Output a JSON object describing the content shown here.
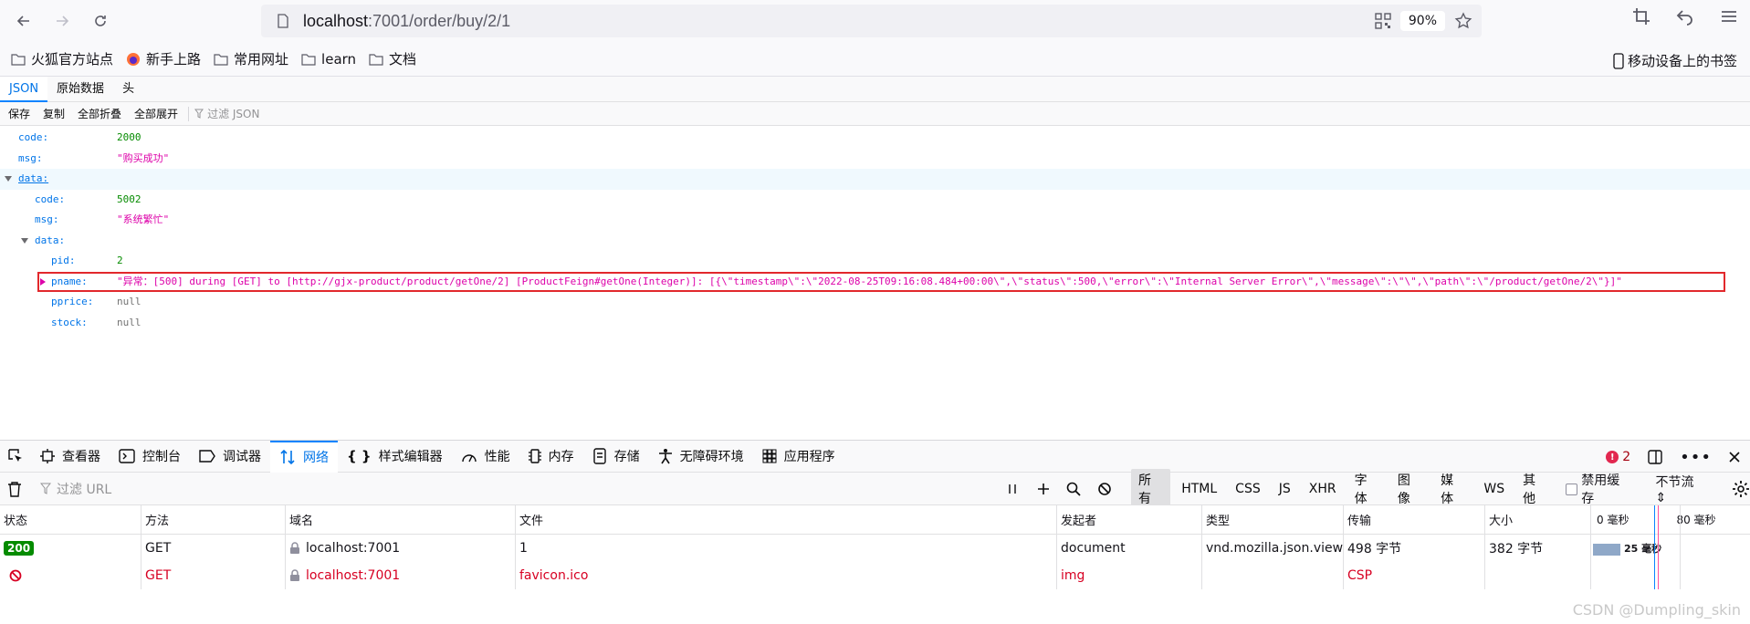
{
  "browser": {
    "url_host": "localhost",
    "url_rest": ":7001/order/buy/2/1",
    "zoom": "90%"
  },
  "bookmarks": [
    {
      "label": "火狐官方站点",
      "icon": "folder-icon"
    },
    {
      "label": "新手上路",
      "icon": "firefox-icon"
    },
    {
      "label": "常用网址",
      "icon": "folder-icon"
    },
    {
      "label": "learn",
      "icon": "folder-icon"
    },
    {
      "label": "文档",
      "icon": "folder-icon"
    }
  ],
  "mobile_bookmarks": "移动设备上的书签",
  "json_viewer": {
    "tabs": [
      "JSON",
      "原始数据",
      "头"
    ],
    "toolbar": [
      "保存",
      "复制",
      "全部折叠",
      "全部展开"
    ],
    "filter_placeholder": "过滤 JSON",
    "rows": [
      {
        "key": "code:",
        "value": "2000",
        "type": "num"
      },
      {
        "key": "msg:",
        "value": "\"购买成功\"",
        "type": "str"
      },
      {
        "key": "data:",
        "value": "",
        "type": "obj"
      },
      {
        "key": "code:",
        "value": "5002",
        "type": "num"
      },
      {
        "key": "msg:",
        "value": "\"系统繁忙\"",
        "type": "str"
      },
      {
        "key": "data:",
        "value": "",
        "type": "obj"
      },
      {
        "key": "pid:",
        "value": "2",
        "type": "num"
      },
      {
        "key": "pname:",
        "value": "\"异常：[500] during [GET] to [http://gjx-product/product/getOne/2] [ProductFeign#getOne(Integer)]: [{\\\"timestamp\\\":\\\"2022-08-25T09:16:08.484+00:00\\\",\\\"status\\\":500,\\\"error\\\":\\\"Internal Server Error\\\",\\\"message\\\":\\\"\\\",\\\"path\\\":\\\"/product/getOne/2\\\"}]\"",
        "type": "str"
      },
      {
        "key": "pprice:",
        "value": "null",
        "type": "null"
      },
      {
        "key": "stock:",
        "value": "null",
        "type": "null"
      }
    ]
  },
  "devtools": {
    "tabs": [
      {
        "label": "查看器",
        "icon": "inspector-icon"
      },
      {
        "label": "控制台",
        "icon": "console-icon"
      },
      {
        "label": "调试器",
        "icon": "debugger-icon"
      },
      {
        "label": "网络",
        "icon": "network-icon"
      },
      {
        "label": "样式编辑器",
        "icon": "style-editor-icon"
      },
      {
        "label": "性能",
        "icon": "performance-icon"
      },
      {
        "label": "内存",
        "icon": "memory-icon"
      },
      {
        "label": "存储",
        "icon": "storage-icon"
      },
      {
        "label": "无障碍环境",
        "icon": "accessibility-icon"
      },
      {
        "label": "应用程序",
        "icon": "application-icon"
      }
    ],
    "error_count": "2",
    "url_filter_placeholder": "过滤 URL",
    "type_filters": [
      "所有",
      "HTML",
      "CSS",
      "JS",
      "XHR",
      "字体",
      "图像",
      "媒体",
      "WS",
      "其他"
    ],
    "disable_cache": "禁用缓存",
    "throttle": "不节流 ⇕",
    "columns": [
      "状态",
      "方法",
      "域名",
      "文件",
      "发起者",
      "类型",
      "传输",
      "大小",
      "0 毫秒",
      "80 毫秒"
    ],
    "requests": [
      {
        "status": "200",
        "method": "GET",
        "domain": "localhost:7001",
        "file": "1",
        "initiator": "document",
        "type": "vnd.mozilla.json.view",
        "transferred": "498 字节",
        "size": "382 字节",
        "timing": "25 毫秒"
      },
      {
        "status": "",
        "method": "GET",
        "domain": "localhost:7001",
        "file": "favicon.ico",
        "initiator": "img",
        "type": "",
        "transferred": "CSP",
        "size": "",
        "timing": ""
      }
    ]
  },
  "watermark": "CSDN @Dumpling_skin",
  "colors": {
    "accent": "#0a84ff",
    "json_key": "#0074e8",
    "json_num": "#058b00",
    "json_str": "#dd00a9",
    "error_red": "#d70022"
  }
}
